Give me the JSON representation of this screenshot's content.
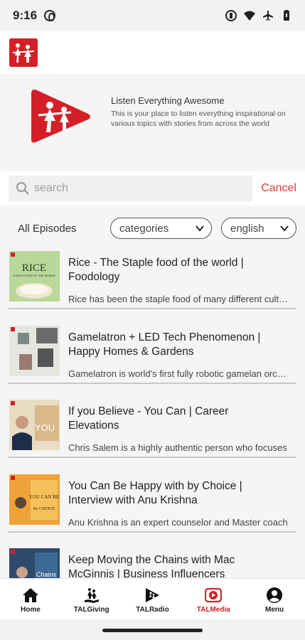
{
  "status_bar": {
    "time": "9:16"
  },
  "hero": {
    "title": "Listen Everything Awesome",
    "description": "This is your place to listen everything inspirational on various topics with stories from across the world"
  },
  "search": {
    "placeholder": "search",
    "cancel_label": "Cancel"
  },
  "filters": {
    "heading": "All Episodes",
    "category_selected": "categories",
    "language_selected": "english"
  },
  "episodes": [
    {
      "title": "Rice - The Staple food of the world | Foodology",
      "description": "Rice has been the staple food of many different cultures",
      "thumb_text": "RICE",
      "thumb_sub": "STAPLE FOOD OF THE WORLD"
    },
    {
      "title": "Gamelatron + LED Tech Phenomenon | Happy Homes & Gardens",
      "description": "Gamelatron is world's first fully robotic gamelan orchestra",
      "thumb_text": "",
      "thumb_sub": ""
    },
    {
      "title": "If you Believe - You Can | Career Elevations",
      "description": "Chris Salem is a highly authentic person who focuses",
      "thumb_text": "YOU",
      "thumb_sub": ""
    },
    {
      "title": "You Can Be Happy with by Choice | Interview with Anu Krishna",
      "description": "Anu Krishna is an expert counselor and Master coach",
      "thumb_text": "YOU CAN BE",
      "thumb_sub": "By CHOICE"
    },
    {
      "title": "Keep Moving the Chains with Mac McGinnis | Business Influencers",
      "description": "",
      "thumb_text": "Chains",
      "thumb_sub": ""
    }
  ],
  "bottom_nav": [
    {
      "label": "Home",
      "icon": "home-icon"
    },
    {
      "label": "TALGiving",
      "icon": "giving-hand-icon"
    },
    {
      "label": "TALRadio",
      "icon": "radio-icon"
    },
    {
      "label": "TALMedia",
      "icon": "media-play-icon"
    },
    {
      "label": "Menu",
      "icon": "account-circle-icon"
    }
  ],
  "colors": {
    "accent": "#d32027",
    "cancel": "#e53935",
    "background": "#f5f5f5"
  }
}
